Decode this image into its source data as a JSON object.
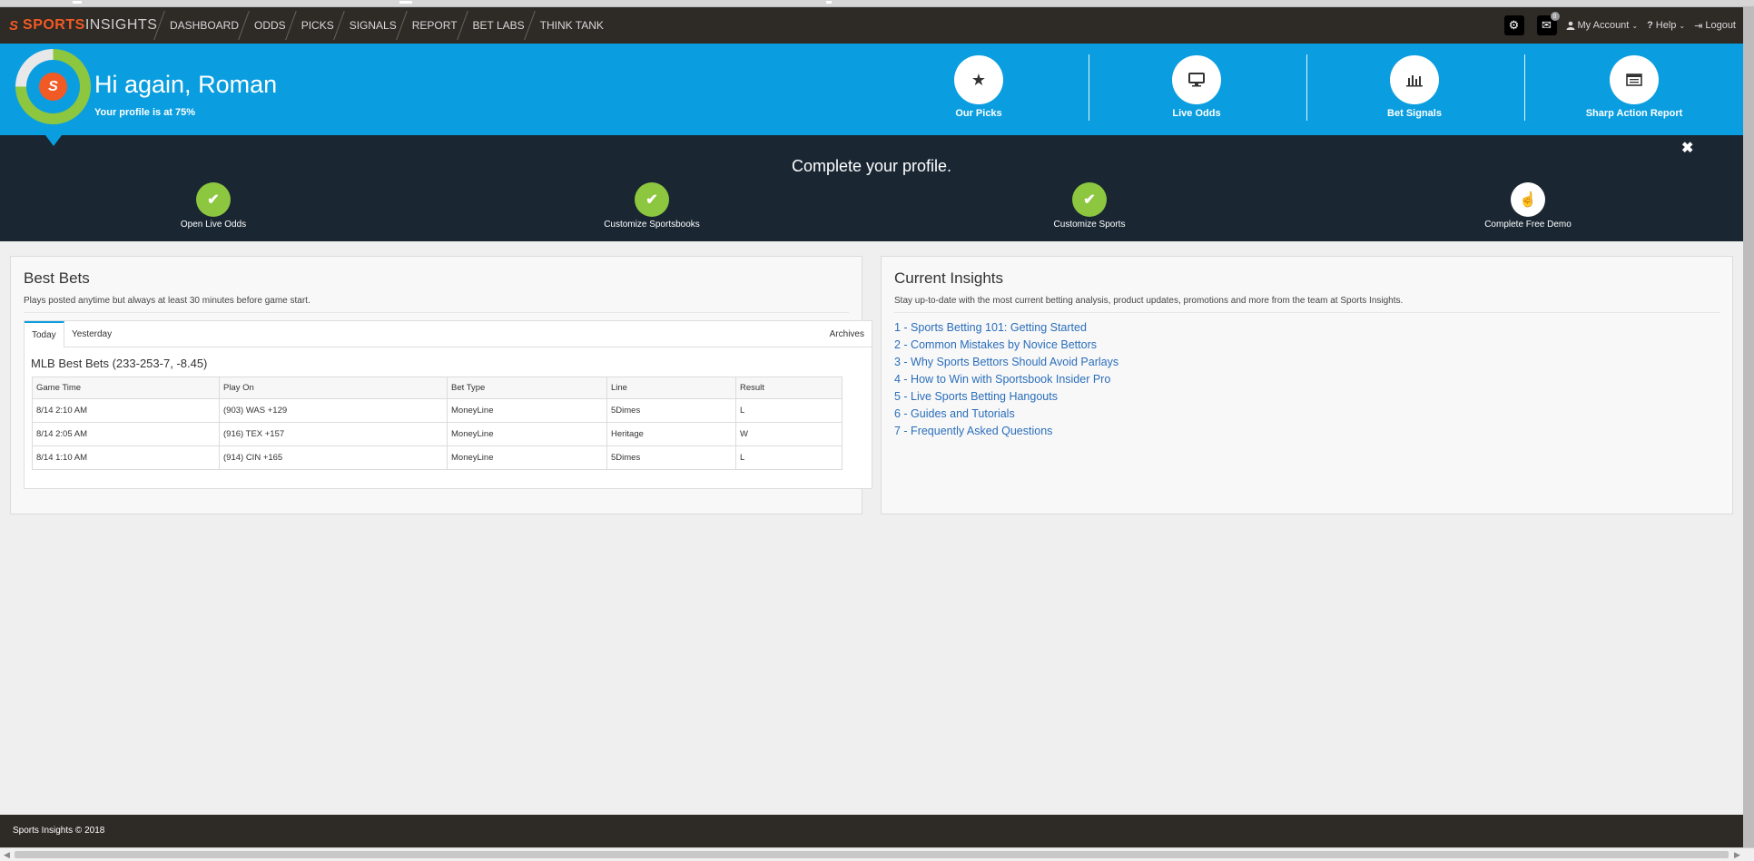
{
  "nav": {
    "brand_part1": "SPORTS",
    "brand_part2": "INSIGHTS",
    "items": [
      "DASHBOARD",
      "ODDS",
      "PICKS",
      "SIGNALS",
      "REPORT",
      "BET LABS",
      "THINK TANK"
    ],
    "mail_badge": "0",
    "my_account": "My Account",
    "help": "Help",
    "logout": "Logout"
  },
  "hero": {
    "greeting": "Hi again, Roman",
    "profile_status": "Your profile is at 75%",
    "profile_percent": 75,
    "quick_links": [
      {
        "label": "Our Picks",
        "icon": "star-icon"
      },
      {
        "label": "Live Odds",
        "icon": "monitor-icon"
      },
      {
        "label": "Bet Signals",
        "icon": "bar-chart-icon"
      },
      {
        "label": "Sharp Action Report",
        "icon": "report-icon"
      }
    ]
  },
  "profile_band": {
    "title": "Complete your profile.",
    "steps": [
      {
        "label": "Open Live Odds",
        "done": true
      },
      {
        "label": "Customize Sportsbooks",
        "done": true
      },
      {
        "label": "Customize Sports",
        "done": true
      },
      {
        "label": "Complete Free Demo",
        "done": false
      }
    ]
  },
  "best_bets": {
    "title": "Best Bets",
    "description": "Plays posted anytime but always at least 30 minutes before game start.",
    "tabs": [
      "Today",
      "Yesterday"
    ],
    "archives": "Archives",
    "table_title": "MLB Best Bets (233-253-7, -8.45)",
    "columns": [
      "Game Time",
      "Play On",
      "Bet Type",
      "Line",
      "Result"
    ],
    "rows": [
      [
        "8/14 2:10 AM",
        "(903) WAS +129",
        "MoneyLine",
        "5Dimes",
        "L"
      ],
      [
        "8/14 2:05 AM",
        "(916) TEX +157",
        "MoneyLine",
        "Heritage",
        "W"
      ],
      [
        "8/14 1:10 AM",
        "(914) CIN +165",
        "MoneyLine",
        "5Dimes",
        "L"
      ]
    ]
  },
  "insights": {
    "title": "Current Insights",
    "description": "Stay up-to-date with the most current betting analysis, product updates, promotions and more from the team at Sports Insights.",
    "links": [
      "1 - Sports Betting 101: Getting Started",
      "2 - Common Mistakes by Novice Bettors",
      "3 - Why Sports Bettors Should Avoid Parlays",
      "4 - How to Win with Sportsbook Insider Pro",
      "5 - Live Sports Betting Hangouts",
      "6 - Guides and Tutorials",
      "7 - Frequently Asked Questions"
    ]
  },
  "footer": {
    "copyright": "Sports Insights © 2018"
  },
  "colors": {
    "brand_orange": "#f15a24",
    "hero_blue": "#0a9ee0",
    "success_green": "#8dc63f",
    "navbar_dark": "#2e2a26",
    "profile_band": "#1a2733",
    "link_blue": "#2a6ebb"
  }
}
